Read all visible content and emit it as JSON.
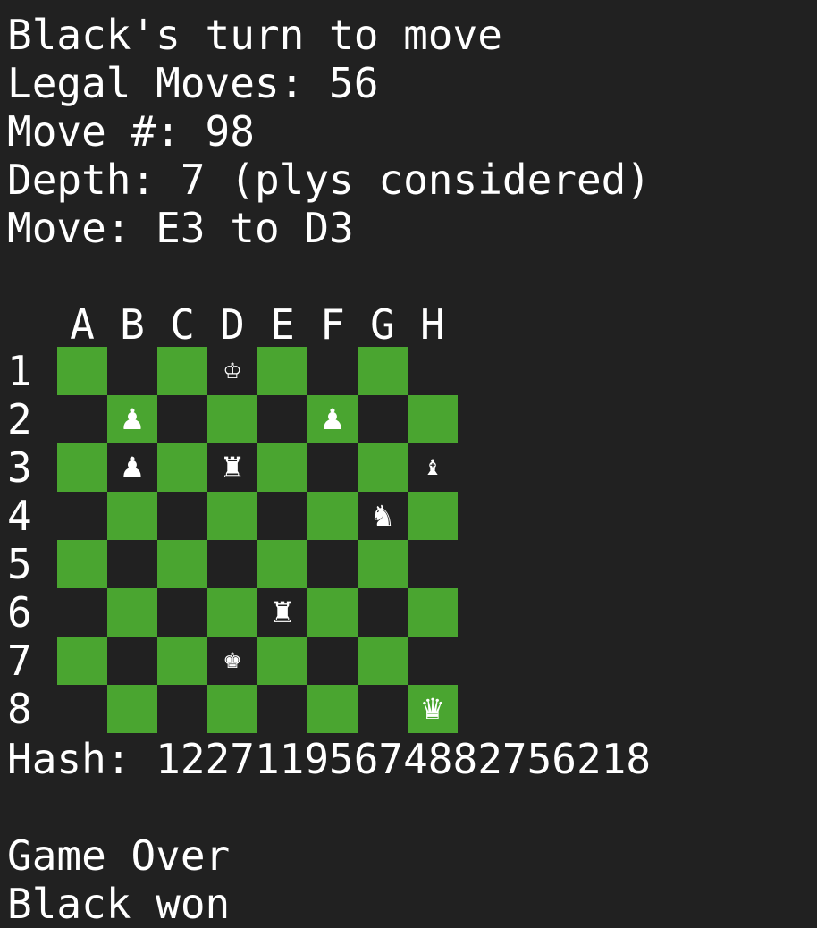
{
  "status": {
    "turn": "Black's turn to move",
    "legal_moves": "Legal Moves: 56",
    "move_number": "Move #: 98",
    "depth": "Depth: 7 (plys considered)",
    "last_move": "Move: E3 to D3"
  },
  "board": {
    "files": [
      "A",
      "B",
      "C",
      "D",
      "E",
      "F",
      "G",
      "H"
    ],
    "ranks": [
      "1",
      "2",
      "3",
      "4",
      "5",
      "6",
      "7",
      "8"
    ],
    "light_color": "#212121",
    "dark_color": "#4aa530",
    "pieces": [
      {
        "square": "D1",
        "glyph": "♔",
        "name": "white-king-icon"
      },
      {
        "square": "B2",
        "glyph": "♟",
        "name": "pawn-icon"
      },
      {
        "square": "F2",
        "glyph": "♟",
        "name": "pawn-icon"
      },
      {
        "square": "B3",
        "glyph": "♟",
        "name": "pawn-icon"
      },
      {
        "square": "D3",
        "glyph": "♜",
        "name": "rook-icon"
      },
      {
        "square": "H3",
        "glyph": "♝",
        "name": "bishop-icon"
      },
      {
        "square": "G4",
        "glyph": "♞",
        "name": "knight-icon"
      },
      {
        "square": "E6",
        "glyph": "♜",
        "name": "rook-icon"
      },
      {
        "square": "D7",
        "glyph": "♚",
        "name": "black-king-icon"
      },
      {
        "square": "H8",
        "glyph": "♛",
        "name": "queen-icon"
      }
    ]
  },
  "hash": "Hash: 12271195674882756218",
  "result": {
    "game_over": "Game Over",
    "winner": "Black won"
  }
}
